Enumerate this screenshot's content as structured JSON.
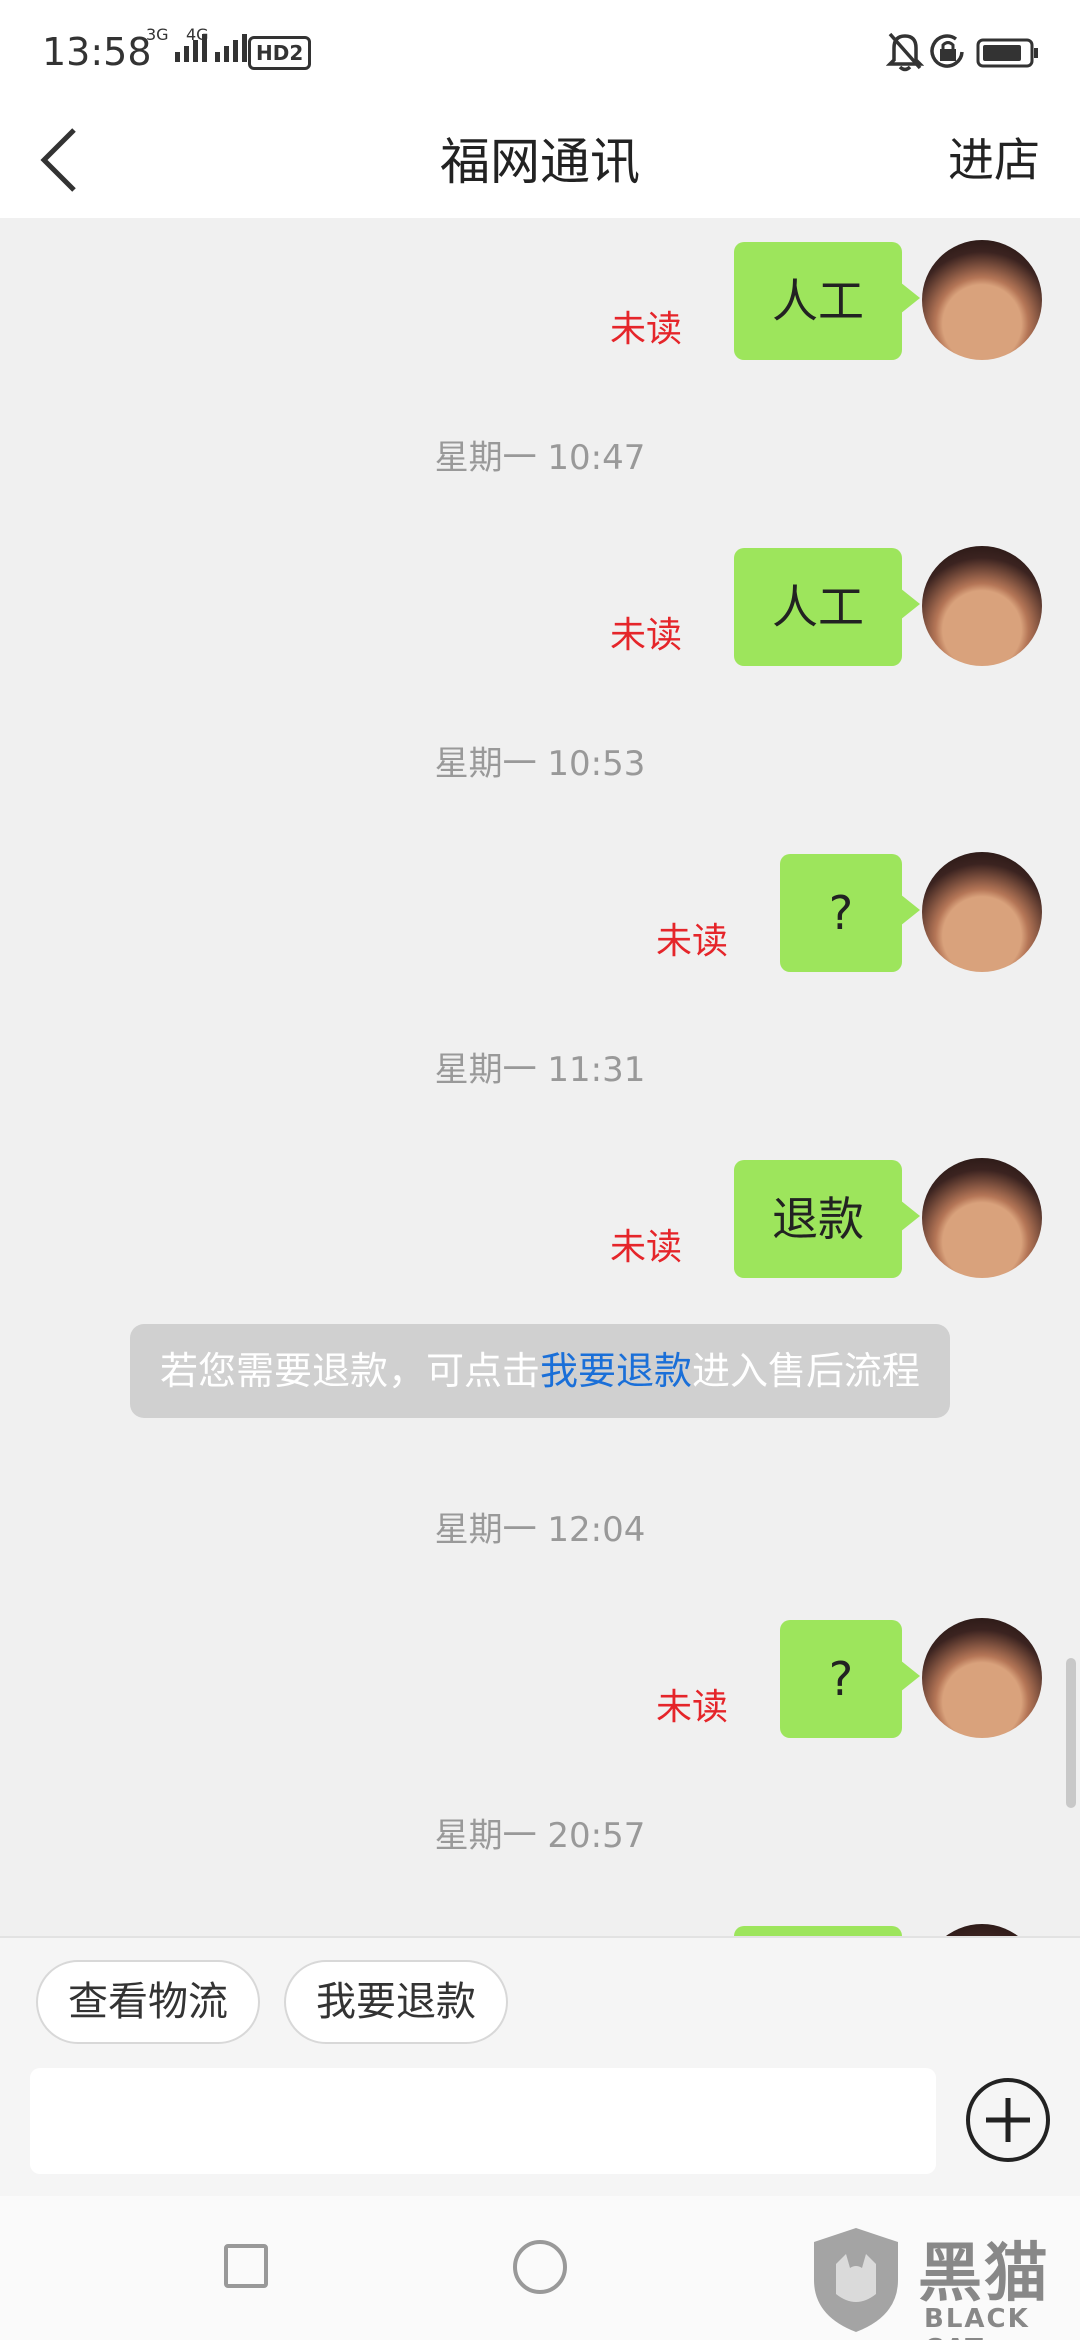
{
  "status_bar": {
    "time": "13:58",
    "network_1": "3G",
    "network_2": "4G",
    "hd_badge": "HD2",
    "icons": [
      "bell-off-icon",
      "lock-rotation-icon",
      "battery-icon"
    ]
  },
  "header": {
    "back_icon": "chevron-left-icon",
    "title": "福网通讯",
    "store_label": "进店"
  },
  "chat": {
    "messages": [
      {
        "type": "sent",
        "text": "人工",
        "status": "未读"
      },
      {
        "type": "time",
        "text": "星期一 10:47"
      },
      {
        "type": "sent",
        "text": "人工",
        "status": "未读"
      },
      {
        "type": "time",
        "text": "星期一 10:53"
      },
      {
        "type": "sent",
        "text": "?",
        "status": "未读"
      },
      {
        "type": "time",
        "text": "星期一 11:31"
      },
      {
        "type": "sent",
        "text": "退款",
        "status": "未读"
      },
      {
        "type": "system",
        "before": "若您需要退款，可点击",
        "link": "我要退款",
        "after": "进入售后流程"
      },
      {
        "type": "time",
        "text": "星期一 12:04"
      },
      {
        "type": "sent",
        "text": "?",
        "status": "未读"
      },
      {
        "type": "time",
        "text": "星期一 20:57"
      }
    ]
  },
  "quick_actions": [
    "查看物流",
    "我要退款"
  ],
  "input": {
    "placeholder": "",
    "plus_icon": "plus-circle-icon"
  },
  "nav": {
    "icons": [
      "recent-apps-square-icon",
      "home-circle-icon",
      "back-triangle-icon"
    ]
  },
  "watermark": {
    "main": "黑猫",
    "sub": "BLACK CAT"
  },
  "colors": {
    "bubble": "#9de55c",
    "unread": "#e5252a",
    "link": "#1a6fd8",
    "timestamp": "#999999"
  }
}
